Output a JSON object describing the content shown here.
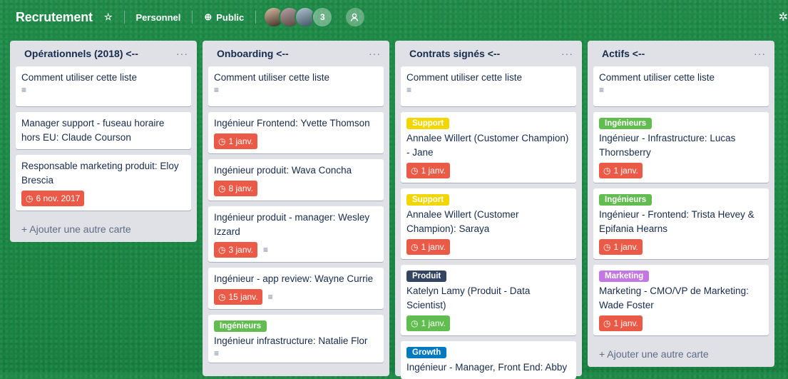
{
  "header": {
    "board_title": "Recrutement",
    "star_icon": "star-icon",
    "team": "Personnel",
    "visibility": "Public",
    "member_count": "3"
  },
  "lists": [
    {
      "title": "Opérationnels (2018) <--",
      "menu": "···",
      "add_card": "+ Ajouter une autre carte",
      "cards": [
        {
          "title": "Comment utiliser cette liste"
        },
        {
          "title": "Manager support - fuseau horaire hors EU: Claude Courson"
        },
        {
          "title": "Responsable marketing produit: Eloy Brescia",
          "due": "6 nov. 2017"
        }
      ]
    },
    {
      "title": "Onboarding <--",
      "menu": "···",
      "cards": [
        {
          "title": "Comment utiliser cette liste"
        },
        {
          "title": "Ingénieur Frontend: Yvette Thomson",
          "due": "1 janv."
        },
        {
          "title": "Ingénieur produit: Wava Concha",
          "due": "8 janv."
        },
        {
          "title": "Ingénieur produit - manager: Wesley Izzard",
          "due": "3 janv."
        },
        {
          "title": "Ingénieur - app review: Wayne Currie",
          "due": "15 janv."
        },
        {
          "label": "Ingénieurs",
          "title": "Ingénieur infrastructure: Natalie Flor"
        }
      ]
    },
    {
      "title": "Contrats signés <--",
      "menu": "···",
      "cards": [
        {
          "title": "Comment utiliser cette liste"
        },
        {
          "label": "Support",
          "title": "Annalee Willert (Customer Champion) - Jane",
          "due": "1 janv."
        },
        {
          "label": "Support",
          "title": "Annalee Willert (Customer Champion): Saraya",
          "due": "1 janv."
        },
        {
          "label": "Produit",
          "title": "Katelyn Lamy (Produit - Data Scientist)",
          "due": "1 janv."
        },
        {
          "label": "Growth",
          "title": "Ingénieur - Manager, Front End: Abby"
        }
      ]
    },
    {
      "title": "Actifs <--",
      "menu": "···",
      "add_card": "+ Ajouter une autre carte",
      "cards": [
        {
          "title": "Comment utiliser cette liste"
        },
        {
          "label": "Ingénieurs",
          "title": "Ingénieur - Infrastructure: Lucas Thornsberry",
          "due": "1 janv."
        },
        {
          "label": "Ingénieurs",
          "title": "Ingénieur - Frontend: Trista Hevey & Epifania Hearns",
          "due": "1 janv."
        },
        {
          "label": "Marketing",
          "title": "Marketing - CMO/VP de Marketing: Wade Foster",
          "due": "1 janv."
        }
      ]
    }
  ],
  "colors": {
    "red_due": "#eb5a46",
    "green_due": "#61bd4f",
    "green_label": "#61bd4f",
    "yellow_label": "#f2d600",
    "dark_label": "#344563",
    "blue_label": "#0079bf",
    "purple_label": "#c377e0"
  }
}
